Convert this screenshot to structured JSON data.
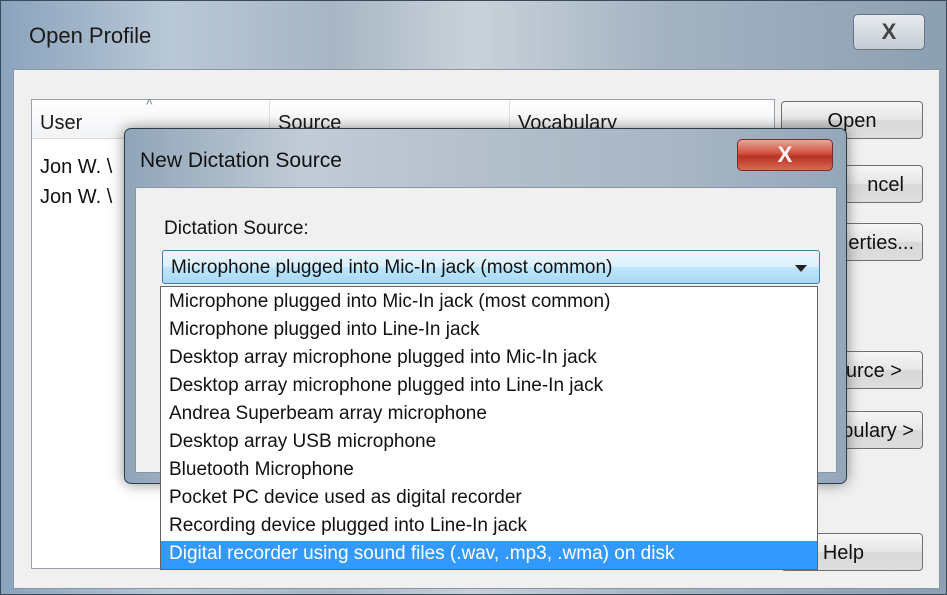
{
  "outer_window": {
    "title": "Open Profile",
    "close_glyph": "X",
    "columns": [
      "User",
      "Source",
      "Vocabulary"
    ],
    "rows": [
      "Jon W. \\",
      "Jon W. \\"
    ],
    "buttons": {
      "open": "Open",
      "cancel": "ncel",
      "properties": "erties...",
      "source": "urce >",
      "vocabulary": "bulary >",
      "help": "Help"
    }
  },
  "dialog": {
    "title": "New Dictation Source",
    "close_glyph": "X",
    "label": "Dictation Source:",
    "selected_value": "Microphone plugged into Mic-In jack (most common)",
    "options": [
      "Microphone plugged into Mic-In jack (most common)",
      "Microphone plugged into Line-In jack",
      "Desktop array microphone plugged into Mic-In jack",
      "Desktop array microphone plugged into Line-In jack",
      "Andrea Superbeam array microphone",
      "Desktop array USB microphone",
      "Bluetooth Microphone",
      "Pocket PC device used as digital recorder",
      "Recording device plugged into Line-In jack",
      "Digital recorder using sound files (.wav, .mp3, .wma) on disk"
    ],
    "highlighted_option_index": 9
  },
  "colors": {
    "highlight": "#3399ff",
    "close_button_red": "#c8402f"
  }
}
